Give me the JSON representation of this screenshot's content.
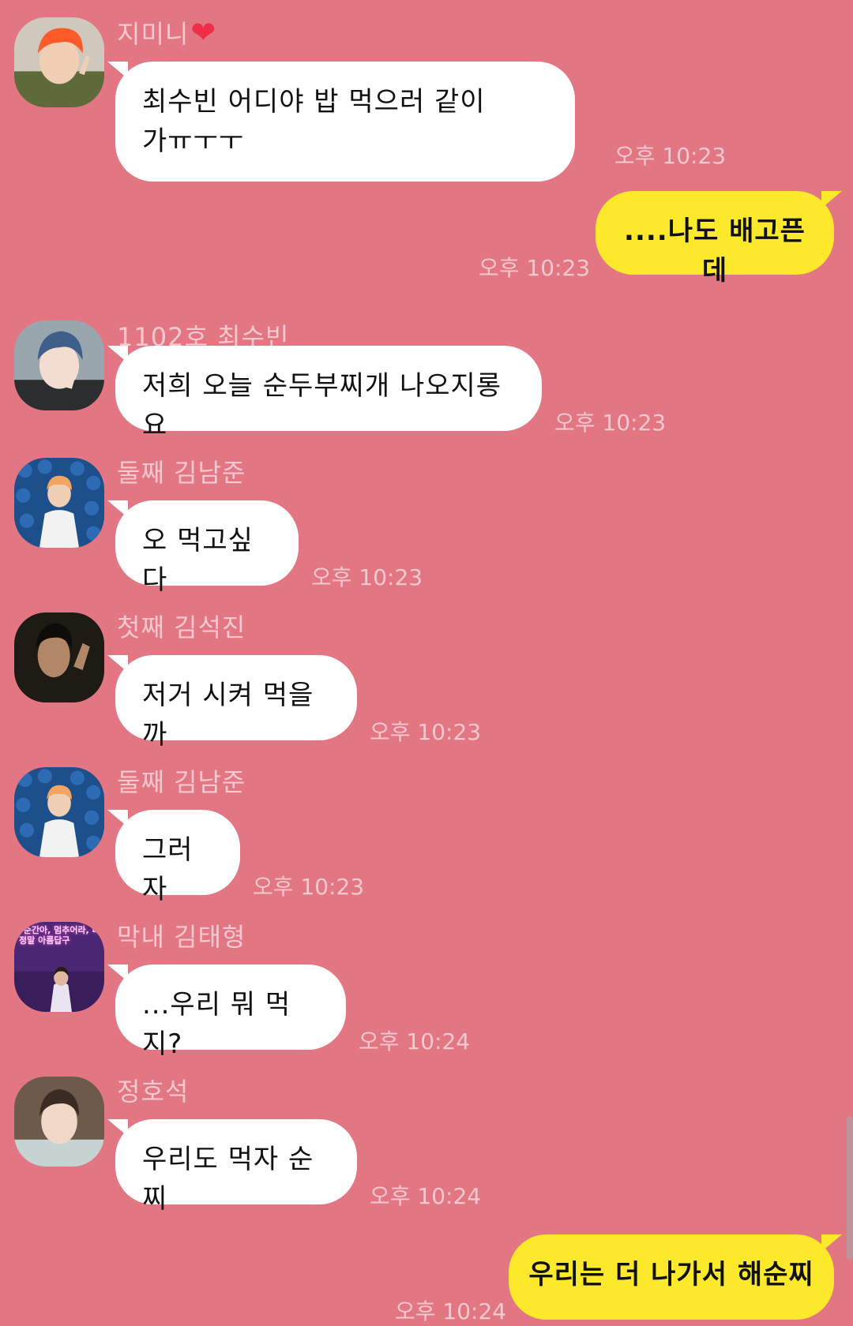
{
  "messages": [
    {
      "type": "in",
      "sender": "지미니",
      "sender_emoji": "❤",
      "avatar": "orange-hair-avatar",
      "text": "최수빈 어디야 밥 먹으러 같이\n가ㅠㅜㅜ",
      "time": "오후 10:23"
    },
    {
      "type": "out",
      "text": "....나도 배고픈데",
      "time": "오후 10:23"
    },
    {
      "type": "in",
      "sender": "1102호 최수빈",
      "avatar": "blue-hair-avatar",
      "text": "저희 오늘 순두부찌개 나오지롱요",
      "time": "오후 10:23"
    },
    {
      "type": "in",
      "sender": "둘째 김남준",
      "avatar": "flower-wall-avatar",
      "text": "오 먹고싶다",
      "time": "오후 10:23"
    },
    {
      "type": "in",
      "sender": "첫째 김석진",
      "avatar": "dark-portrait-avatar",
      "text": "저거 시켜 먹을까",
      "time": "오후 10:23"
    },
    {
      "type": "in",
      "sender": "둘째 김남준",
      "avatar": "flower-wall-avatar",
      "text": "그러자",
      "time": "오후 10:23"
    },
    {
      "type": "in",
      "sender": "막내 김태형",
      "avatar": "neon-sign-avatar",
      "avatar_text": "\"순간아, 멈추어라, 너 정말 아름답구",
      "text": "...우리 뭐 먹지?",
      "time": "오후 10:24"
    },
    {
      "type": "in",
      "sender": "정호석",
      "avatar": "portrait-avatar",
      "text": "우리도 먹자 순찌",
      "time": "오후 10:24"
    },
    {
      "type": "out",
      "text": "우리는 더 나가서 해순찌",
      "time": "오후 10:24"
    }
  ],
  "colors": {
    "background": "#e27683",
    "incoming_bubble": "#ffffff",
    "outgoing_bubble": "#fde92b",
    "meta_text": "#f7c9cf"
  }
}
